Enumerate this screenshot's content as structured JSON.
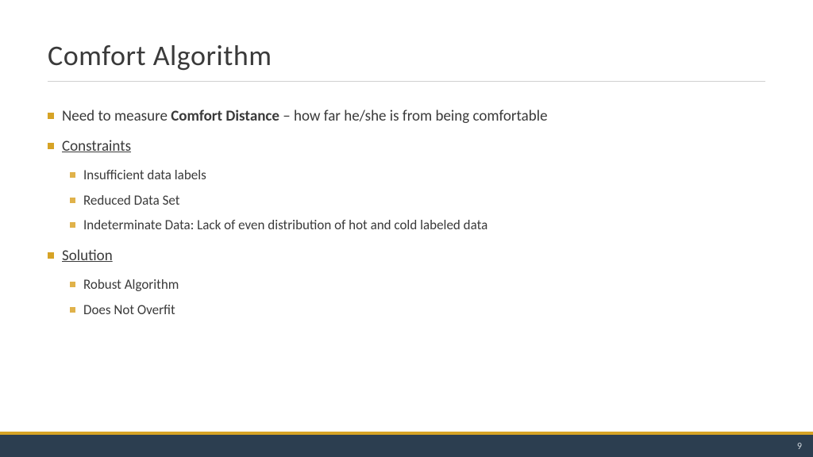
{
  "title": "Comfort Algorithm",
  "bullets": {
    "b1_pre": "Need to measure ",
    "b1_bold": "Comfort Distance",
    "b1_post": " – how far he/she is from being comfortable",
    "b2": "Constraints",
    "b2_sub1": "Insufficient data labels",
    "b2_sub2": "Reduced Data Set",
    "b2_sub3": "Indeterminate Data: Lack of even distribution of hot and cold labeled data",
    "b3": "Solution",
    "b3_sub1": "Robust Algorithm",
    "b3_sub2": "Does Not Overfit"
  },
  "page_number": "9"
}
